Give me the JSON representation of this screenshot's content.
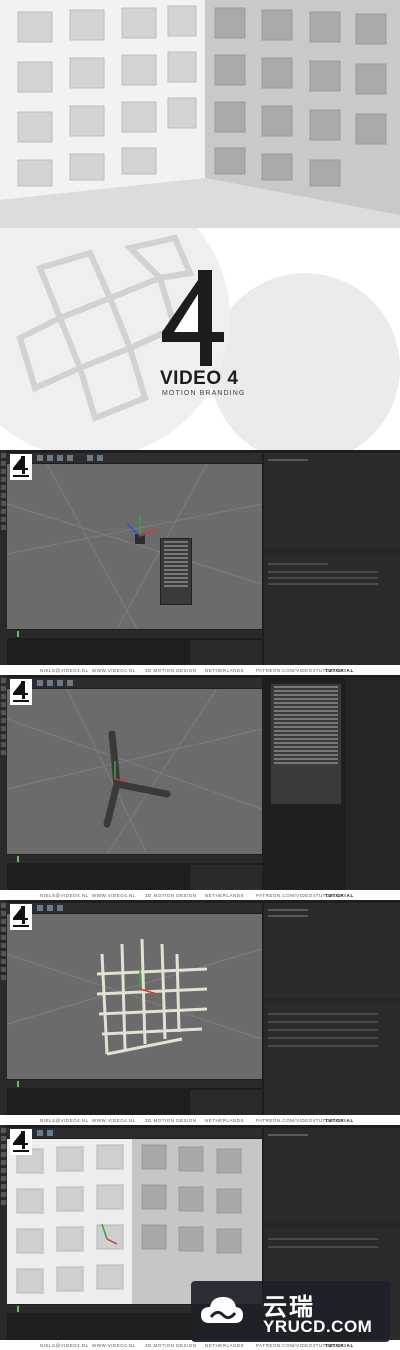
{
  "brand": {
    "numeral": "4",
    "title": "VIDEO 4",
    "subtitle": "MOTION BRANDING",
    "badge_numeral": "4",
    "badge_text": "VIDEO 4"
  },
  "footer": {
    "email": "NIELS@VIDEO4.NL",
    "site": "WWW.VIDEO4.NL",
    "service": "3D MOTION DESIGN",
    "country": "NETHERLANDS",
    "patreon": "PATREON.COM/VIDEO4TUTORIAL",
    "tag": "TUTORIAL"
  },
  "panels": [
    {
      "id": "panel-1",
      "subject": "cube-with-context-menu"
    },
    {
      "id": "panel-2",
      "subject": "three-axis-beams"
    },
    {
      "id": "panel-3",
      "subject": "lattice-cube"
    },
    {
      "id": "panel-4",
      "subject": "final-render"
    }
  ],
  "watermark": {
    "cn": "云瑞",
    "en": "YRUCD.COM"
  },
  "colors": {
    "ui_bg": "#1e1e1e",
    "viewport_bg": "#6b6b6b",
    "accent_green": "#58c26a",
    "axis_red": "#d23a3a",
    "axis_green": "#2ca84a",
    "axis_blue": "#2f4fd8"
  }
}
